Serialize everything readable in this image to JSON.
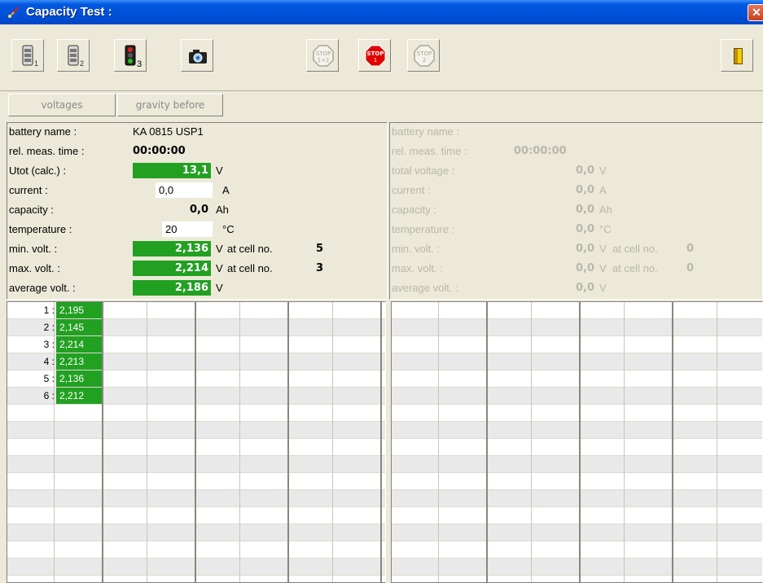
{
  "window": {
    "title": "Capacity Test :",
    "close_glyph": "✕"
  },
  "toolbar": {
    "buttons": [
      {
        "icon": "battery-1-icon",
        "sub": "1"
      },
      {
        "icon": "battery-2-icon",
        "sub": "2"
      },
      {
        "icon": "traffic-light-3-icon",
        "sub": "3"
      },
      {
        "icon": "camera-icon"
      },
      {
        "icon": "stop-1-2-icon",
        "label": "STOP",
        "sub": "1+2"
      },
      {
        "icon": "stop-1-icon",
        "label": "STOP",
        "sub": "1"
      },
      {
        "icon": "stop-2-icon",
        "label": "STOP",
        "sub": "2"
      },
      {
        "icon": "exit-door-icon"
      }
    ]
  },
  "tabs": [
    {
      "label": "voltages"
    },
    {
      "label": "gravity before"
    }
  ],
  "left": {
    "battery_name_label": "battery name :",
    "battery_name": "KA 0815 USP1",
    "meas_time_label": "rel. meas. time :",
    "meas_time": "00:00:00",
    "utot_label": "Utot (calc.) :",
    "utot": "13,1",
    "utot_unit": "V",
    "current_label": "current :",
    "current": "0,0",
    "current_unit": "A",
    "capacity_label": "capacity :",
    "capacity": "0,0",
    "capacity_unit": "Ah",
    "temperature_label": "temperature :",
    "temperature": "20",
    "temperature_unit": "°C",
    "min_volt_label": "min. volt. :",
    "min_volt": "2,136",
    "min_volt_unit": "V",
    "min_at_label": "at cell no.",
    "min_cell": "5",
    "max_volt_label": "max. volt. :",
    "max_volt": "2,214",
    "max_volt_unit": "V",
    "max_at_label": "at cell no.",
    "max_cell": "3",
    "avg_volt_label": "average volt. :",
    "avg_volt": "2,186",
    "avg_volt_unit": "V"
  },
  "right": {
    "battery_name_label": "battery name :",
    "meas_time_label": "rel. meas. time :",
    "meas_time": "00:00:00",
    "total_label": "total voltage :",
    "total": "0,0",
    "total_unit": "V",
    "current_label": "current :",
    "current": "0,0",
    "current_unit": "A",
    "capacity_label": "capacity :",
    "capacity": "0,0",
    "capacity_unit": "Ah",
    "temperature_label": "temperature :",
    "temperature": "0,0",
    "temperature_unit": "°C",
    "min_volt_label": "min. volt. :",
    "min_volt": "0,0",
    "min_volt_unit": "V",
    "min_at_label": "at cell no.",
    "min_cell": "0",
    "max_volt_label": "max. volt. :",
    "max_volt": "0,0",
    "max_volt_unit": "V",
    "max_at_label": "at cell no.",
    "max_cell": "0",
    "avg_volt_label": "average volt. :",
    "avg_volt": "0,0",
    "avg_volt_unit": "V"
  },
  "cells": [
    {
      "no": "1 :",
      "v": "2,195"
    },
    {
      "no": "2 :",
      "v": "2,145"
    },
    {
      "no": "3 :",
      "v": "2,214"
    },
    {
      "no": "4 :",
      "v": "2,213"
    },
    {
      "no": "5 :",
      "v": "2,136"
    },
    {
      "no": "6 :",
      "v": "2,212"
    }
  ],
  "colors": {
    "title_bar": "#0050d8",
    "green_value": "#22a022",
    "stop_red": "#e00000",
    "panel_bg": "#ece9d8"
  }
}
